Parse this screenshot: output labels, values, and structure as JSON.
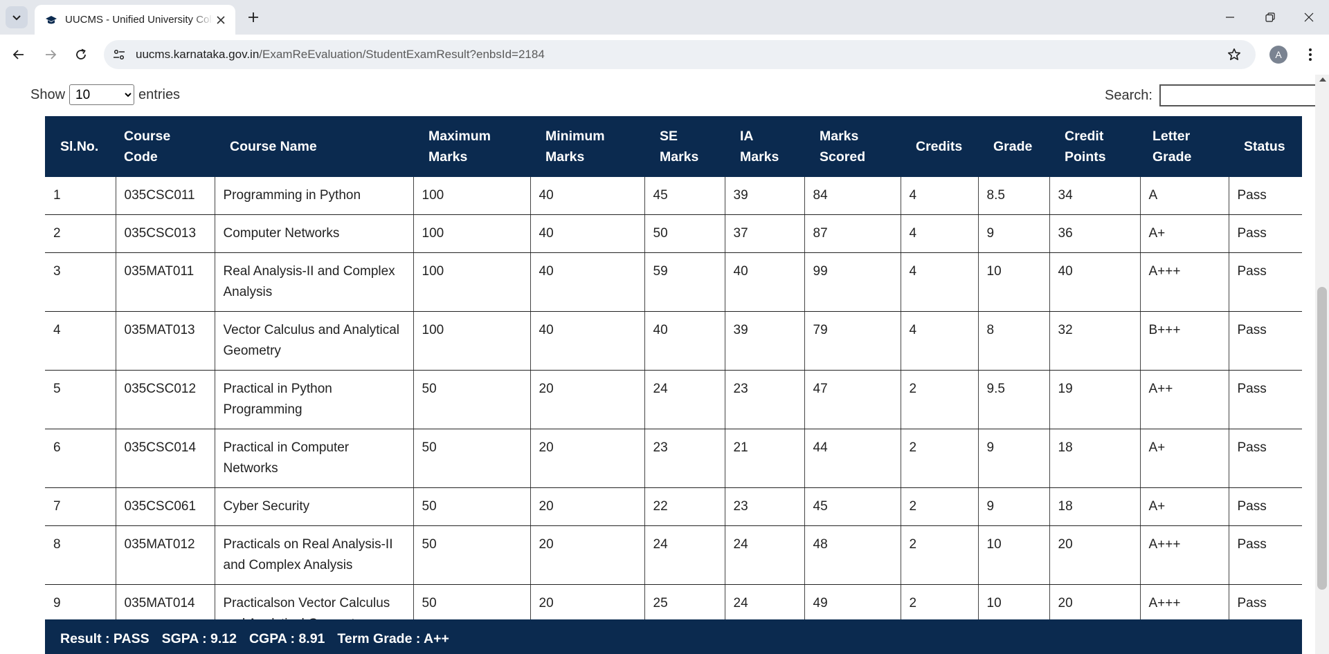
{
  "browser": {
    "tab_title": "UUCMS - Unified University College Management System",
    "url_host": "uucms.karnataka.gov.in",
    "url_path": "/ExamReEvaluation/StudentExamResult?enbsId=2184",
    "profile_initial": "A"
  },
  "table_controls": {
    "show_label": "Show",
    "entries_value": "10",
    "entries_label": "entries",
    "search_label": "Search:"
  },
  "table": {
    "headers": {
      "slno": "Sl.No.",
      "course_code": "Course Code",
      "course_name": "Course Name",
      "max_marks": "Maximum Marks",
      "min_marks": "Minimum Marks",
      "se_marks": "SE Marks",
      "ia_marks": "IA Marks",
      "marks_scored": "Marks Scored",
      "credits": "Credits",
      "grade": "Grade",
      "credit_points": "Credit Points",
      "letter_grade": "Letter Grade",
      "status": "Status"
    },
    "rows": [
      {
        "slno": "1",
        "code": "035CSC011",
        "name": "Programming in Python",
        "max": "100",
        "min": "40",
        "se": "45",
        "ia": "39",
        "scored": "84",
        "credits": "4",
        "grade": "8.5",
        "points": "34",
        "letter": "A",
        "status": "Pass"
      },
      {
        "slno": "2",
        "code": "035CSC013",
        "name": "Computer Networks",
        "max": "100",
        "min": "40",
        "se": "50",
        "ia": "37",
        "scored": "87",
        "credits": "4",
        "grade": "9",
        "points": "36",
        "letter": "A+",
        "status": "Pass"
      },
      {
        "slno": "3",
        "code": "035MAT011",
        "name": "Real Analysis-II and Complex Analysis",
        "max": "100",
        "min": "40",
        "se": "59",
        "ia": "40",
        "scored": "99",
        "credits": "4",
        "grade": "10",
        "points": "40",
        "letter": "A+++",
        "status": "Pass"
      },
      {
        "slno": "4",
        "code": "035MAT013",
        "name": "Vector Calculus and Analytical Geometry",
        "max": "100",
        "min": "40",
        "se": "40",
        "ia": "39",
        "scored": "79",
        "credits": "4",
        "grade": "8",
        "points": "32",
        "letter": "B+++",
        "status": "Pass"
      },
      {
        "slno": "5",
        "code": "035CSC012",
        "name": "Practical in Python Programming",
        "max": "50",
        "min": "20",
        "se": "24",
        "ia": "23",
        "scored": "47",
        "credits": "2",
        "grade": "9.5",
        "points": "19",
        "letter": "A++",
        "status": "Pass"
      },
      {
        "slno": "6",
        "code": "035CSC014",
        "name": "Practical in Computer Networks",
        "max": "50",
        "min": "20",
        "se": "23",
        "ia": "21",
        "scored": "44",
        "credits": "2",
        "grade": "9",
        "points": "18",
        "letter": "A+",
        "status": "Pass"
      },
      {
        "slno": "7",
        "code": "035CSC061",
        "name": "Cyber Security",
        "max": "50",
        "min": "20",
        "se": "22",
        "ia": "23",
        "scored": "45",
        "credits": "2",
        "grade": "9",
        "points": "18",
        "letter": "A+",
        "status": "Pass"
      },
      {
        "slno": "8",
        "code": "035MAT012",
        "name": "Practicals on Real Analysis-II and Complex Analysis",
        "max": "50",
        "min": "20",
        "se": "24",
        "ia": "24",
        "scored": "48",
        "credits": "2",
        "grade": "10",
        "points": "20",
        "letter": "A+++",
        "status": "Pass"
      },
      {
        "slno": "9",
        "code": "035MAT014",
        "name": "Practicalson Vector Calculus and Analytical Geometry",
        "max": "50",
        "min": "20",
        "se": "25",
        "ia": "24",
        "scored": "49",
        "credits": "2",
        "grade": "10",
        "points": "20",
        "letter": "A+++",
        "status": "Pass"
      }
    ]
  },
  "summary": {
    "result": "Result : PASS",
    "sgpa": "SGPA : 9.12",
    "cgpa": "CGPA : 8.91",
    "term_grade": "Term Grade : A++"
  },
  "colors": {
    "header_bg": "#0b2a4f",
    "chrome_bg": "#e4e7ec"
  }
}
